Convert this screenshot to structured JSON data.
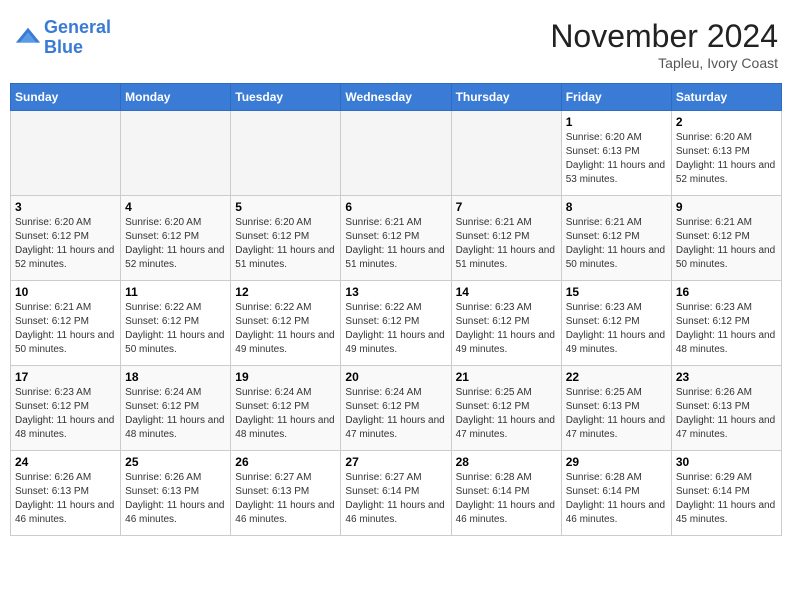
{
  "logo": {
    "line1": "General",
    "line2": "Blue"
  },
  "title": "November 2024",
  "location": "Tapleu, Ivory Coast",
  "days_of_week": [
    "Sunday",
    "Monday",
    "Tuesday",
    "Wednesday",
    "Thursday",
    "Friday",
    "Saturday"
  ],
  "weeks": [
    [
      {
        "day": "",
        "info": ""
      },
      {
        "day": "",
        "info": ""
      },
      {
        "day": "",
        "info": ""
      },
      {
        "day": "",
        "info": ""
      },
      {
        "day": "",
        "info": ""
      },
      {
        "day": "1",
        "info": "Sunrise: 6:20 AM\nSunset: 6:13 PM\nDaylight: 11 hours and 53 minutes."
      },
      {
        "day": "2",
        "info": "Sunrise: 6:20 AM\nSunset: 6:13 PM\nDaylight: 11 hours and 52 minutes."
      }
    ],
    [
      {
        "day": "3",
        "info": "Sunrise: 6:20 AM\nSunset: 6:12 PM\nDaylight: 11 hours and 52 minutes."
      },
      {
        "day": "4",
        "info": "Sunrise: 6:20 AM\nSunset: 6:12 PM\nDaylight: 11 hours and 52 minutes."
      },
      {
        "day": "5",
        "info": "Sunrise: 6:20 AM\nSunset: 6:12 PM\nDaylight: 11 hours and 51 minutes."
      },
      {
        "day": "6",
        "info": "Sunrise: 6:21 AM\nSunset: 6:12 PM\nDaylight: 11 hours and 51 minutes."
      },
      {
        "day": "7",
        "info": "Sunrise: 6:21 AM\nSunset: 6:12 PM\nDaylight: 11 hours and 51 minutes."
      },
      {
        "day": "8",
        "info": "Sunrise: 6:21 AM\nSunset: 6:12 PM\nDaylight: 11 hours and 50 minutes."
      },
      {
        "day": "9",
        "info": "Sunrise: 6:21 AM\nSunset: 6:12 PM\nDaylight: 11 hours and 50 minutes."
      }
    ],
    [
      {
        "day": "10",
        "info": "Sunrise: 6:21 AM\nSunset: 6:12 PM\nDaylight: 11 hours and 50 minutes."
      },
      {
        "day": "11",
        "info": "Sunrise: 6:22 AM\nSunset: 6:12 PM\nDaylight: 11 hours and 50 minutes."
      },
      {
        "day": "12",
        "info": "Sunrise: 6:22 AM\nSunset: 6:12 PM\nDaylight: 11 hours and 49 minutes."
      },
      {
        "day": "13",
        "info": "Sunrise: 6:22 AM\nSunset: 6:12 PM\nDaylight: 11 hours and 49 minutes."
      },
      {
        "day": "14",
        "info": "Sunrise: 6:23 AM\nSunset: 6:12 PM\nDaylight: 11 hours and 49 minutes."
      },
      {
        "day": "15",
        "info": "Sunrise: 6:23 AM\nSunset: 6:12 PM\nDaylight: 11 hours and 49 minutes."
      },
      {
        "day": "16",
        "info": "Sunrise: 6:23 AM\nSunset: 6:12 PM\nDaylight: 11 hours and 48 minutes."
      }
    ],
    [
      {
        "day": "17",
        "info": "Sunrise: 6:23 AM\nSunset: 6:12 PM\nDaylight: 11 hours and 48 minutes."
      },
      {
        "day": "18",
        "info": "Sunrise: 6:24 AM\nSunset: 6:12 PM\nDaylight: 11 hours and 48 minutes."
      },
      {
        "day": "19",
        "info": "Sunrise: 6:24 AM\nSunset: 6:12 PM\nDaylight: 11 hours and 48 minutes."
      },
      {
        "day": "20",
        "info": "Sunrise: 6:24 AM\nSunset: 6:12 PM\nDaylight: 11 hours and 47 minutes."
      },
      {
        "day": "21",
        "info": "Sunrise: 6:25 AM\nSunset: 6:12 PM\nDaylight: 11 hours and 47 minutes."
      },
      {
        "day": "22",
        "info": "Sunrise: 6:25 AM\nSunset: 6:13 PM\nDaylight: 11 hours and 47 minutes."
      },
      {
        "day": "23",
        "info": "Sunrise: 6:26 AM\nSunset: 6:13 PM\nDaylight: 11 hours and 47 minutes."
      }
    ],
    [
      {
        "day": "24",
        "info": "Sunrise: 6:26 AM\nSunset: 6:13 PM\nDaylight: 11 hours and 46 minutes."
      },
      {
        "day": "25",
        "info": "Sunrise: 6:26 AM\nSunset: 6:13 PM\nDaylight: 11 hours and 46 minutes."
      },
      {
        "day": "26",
        "info": "Sunrise: 6:27 AM\nSunset: 6:13 PM\nDaylight: 11 hours and 46 minutes."
      },
      {
        "day": "27",
        "info": "Sunrise: 6:27 AM\nSunset: 6:14 PM\nDaylight: 11 hours and 46 minutes."
      },
      {
        "day": "28",
        "info": "Sunrise: 6:28 AM\nSunset: 6:14 PM\nDaylight: 11 hours and 46 minutes."
      },
      {
        "day": "29",
        "info": "Sunrise: 6:28 AM\nSunset: 6:14 PM\nDaylight: 11 hours and 46 minutes."
      },
      {
        "day": "30",
        "info": "Sunrise: 6:29 AM\nSunset: 6:14 PM\nDaylight: 11 hours and 45 minutes."
      }
    ]
  ]
}
